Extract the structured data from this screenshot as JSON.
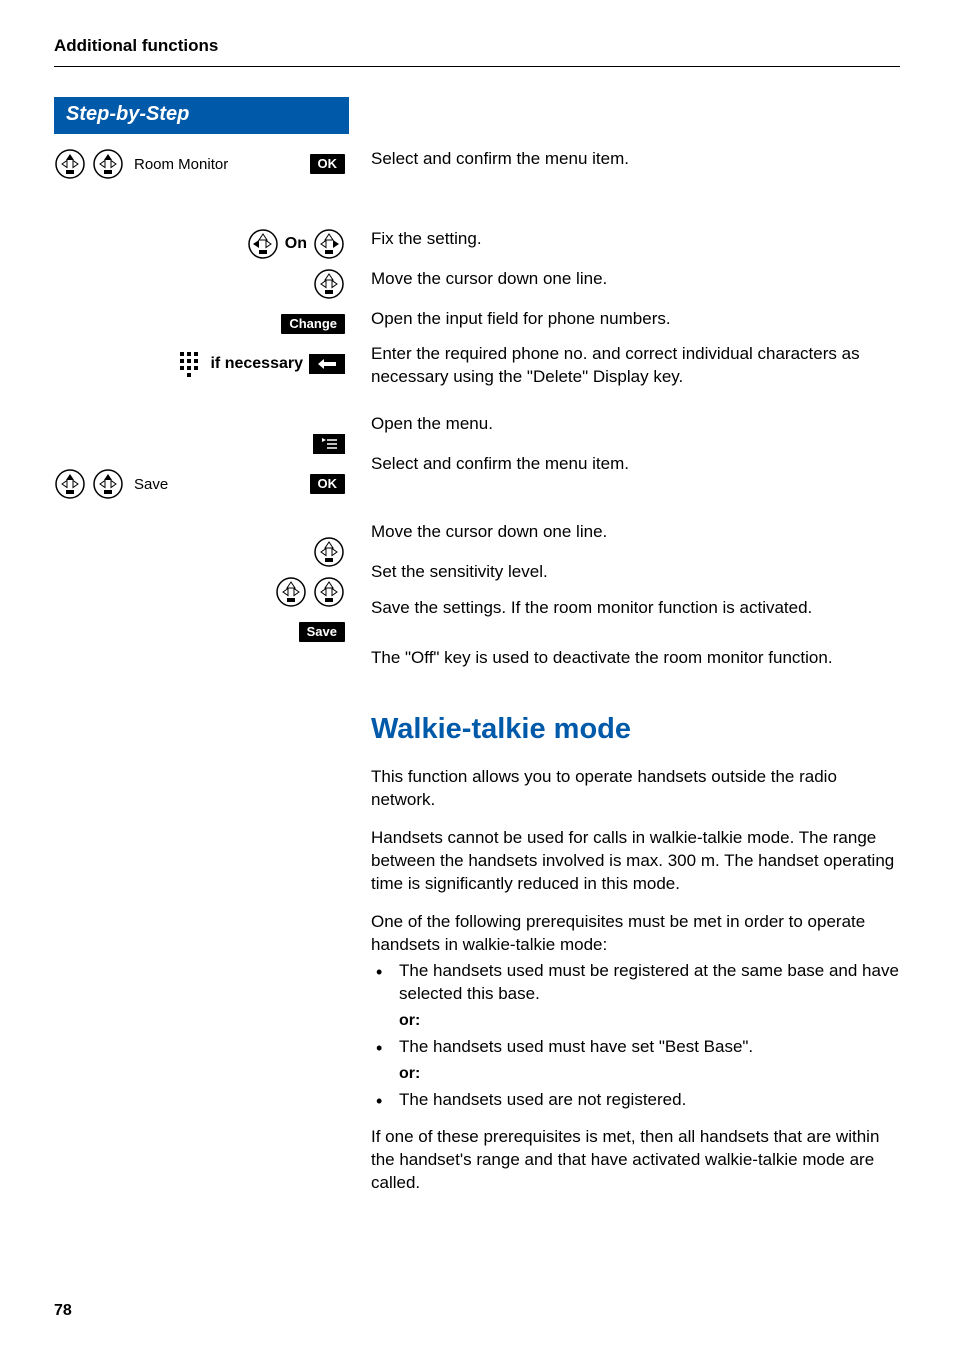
{
  "header": {
    "title": "Additional functions"
  },
  "stepHeader": "Step-by-Step",
  "pageNumber": "78",
  "left": {
    "roomMonitor": "Room Monitor",
    "ok": "OK",
    "on": "On",
    "change": "Change",
    "ifNecessary": "if necessary",
    "save": "Save",
    "saveKey": "Save"
  },
  "right": {
    "r1": "Select and confirm the menu item.",
    "r2": "Fix the setting.",
    "r3": "Move the cursor down one line.",
    "r4": "Open the input field for phone numbers.",
    "r5": "Enter the required phone no. and correct individual characters as necessary using the \"Delete\" Display key.",
    "r6": "Open the menu.",
    "r7": "Select and confirm the menu item.",
    "r8": "Move the cursor down one line.",
    "r9": "Set the sensitivity level.",
    "r10": "Save the settings. If the room monitor function is activated.",
    "r11": "The \"Off\" key is used to deactivate the room monitor function."
  },
  "section": {
    "heading": "Walkie-talkie mode",
    "p1": "This function allows you to operate handsets outside the radio network.",
    "p2": "Handsets cannot be used for calls in walkie-talkie mode. The range between the handsets involved is max. 300 m. The handset operating time is significantly reduced in this mode.",
    "p3": "One of the following prerequisites must be met in order to operate handsets in walkie-talkie mode:",
    "b1": "The handsets used must be registered at the same base and have selected this base.",
    "or": "or:",
    "b2": "The handsets used must have set \"Best Base\".",
    "b3": "The handsets used are not registered.",
    "p4": "If one of these prerequisites is met, then all handsets that are within the handset's range and that have activated walkie-talkie mode are called."
  }
}
